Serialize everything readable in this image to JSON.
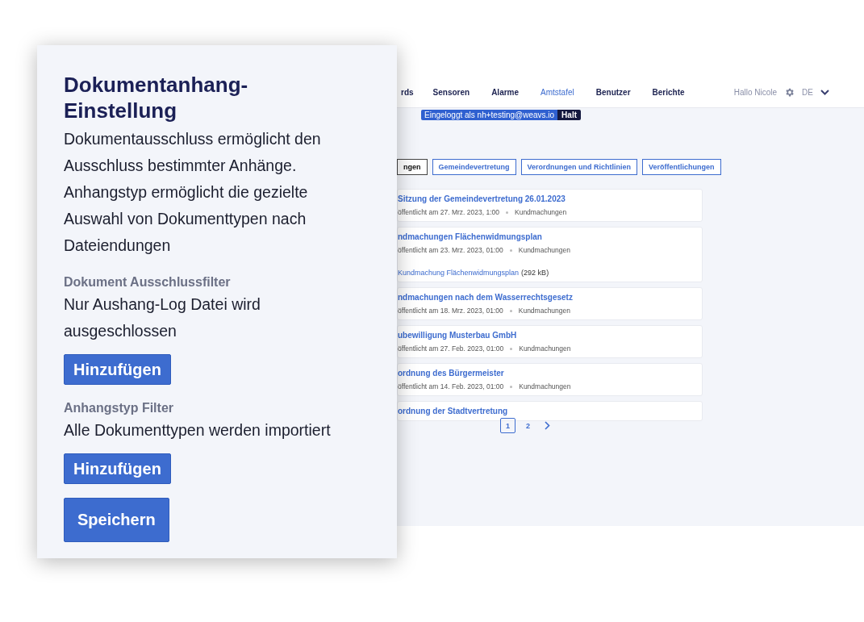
{
  "nav": {
    "items": [
      {
        "label": "rds",
        "selected": false
      },
      {
        "label": "Sensoren",
        "selected": false
      },
      {
        "label": "Alarme",
        "selected": false
      },
      {
        "label": "Amtstafel",
        "selected": true
      },
      {
        "label": "Benutzer",
        "selected": false
      },
      {
        "label": "Berichte",
        "selected": false
      }
    ],
    "greeting": "Hallo Nicole",
    "language": "DE"
  },
  "login_banner": {
    "text": "Eingeloggt als nh+testing@weavs.io",
    "action": "Halt"
  },
  "filter_tabs": [
    {
      "label": "ngen",
      "selected": true
    },
    {
      "label": "Gemeindevertretung",
      "selected": false
    },
    {
      "label": "Verordnungen und Richtlinien",
      "selected": false
    },
    {
      "label": "Veröffentlichungen",
      "selected": false
    }
  ],
  "posts": [
    {
      "title": "Sitzung der Gemeindevertretung 26.01.2023",
      "published": "öffentlicht am 27. Mrz. 2023, 1:00",
      "category": "Kundmachungen"
    },
    {
      "title": "ndmachungen Flächenwidmungsplan",
      "published": "öffentlicht am 23. Mrz. 2023, 01:00",
      "category": "Kundmachungen",
      "attachment": {
        "name": "Kundmachung Flächenwidmungsplan",
        "size": "(292 kB)"
      }
    },
    {
      "title": "ndmachungen nach dem Wasserrechtsgesetz",
      "published": "öffentlicht am 18. Mrz. 2023, 01:00",
      "category": "Kundmachungen"
    },
    {
      "title": "ubewilligung Musterbau GmbH",
      "published": "öffentlicht am 27. Feb. 2023, 01:00",
      "category": "Kundmachungen"
    },
    {
      "title": "ordnung des Bürgermeister",
      "published": "öffentlicht am 14. Feb. 2023, 01:00",
      "category": "Kundmachungen"
    },
    {
      "title": "ordnung der Stadtvertretung"
    }
  ],
  "pagination": {
    "pages": [
      {
        "label": "1",
        "selected": true
      },
      {
        "label": "2",
        "selected": false
      }
    ]
  },
  "panel": {
    "title": "Dokumentanhang-Einstellung",
    "description": "Dokumentausschluss ermöglicht den Ausschluss bestimmter Anhänge. Anhangstyp ermöglicht die gezielte Auswahl von Dokumenttypen nach Dateiendungen",
    "sections": [
      {
        "label": "Dokument Ausschlussfilter",
        "value": "Nur Aushang-Log Datei wird ausgeschlossen",
        "button": "Hinzufügen"
      },
      {
        "label": "Anhangstyp Filter",
        "value": "Alle Dokumenttypen werden importiert",
        "button": "Hinzufügen"
      }
    ],
    "save_button": "Speichern"
  }
}
